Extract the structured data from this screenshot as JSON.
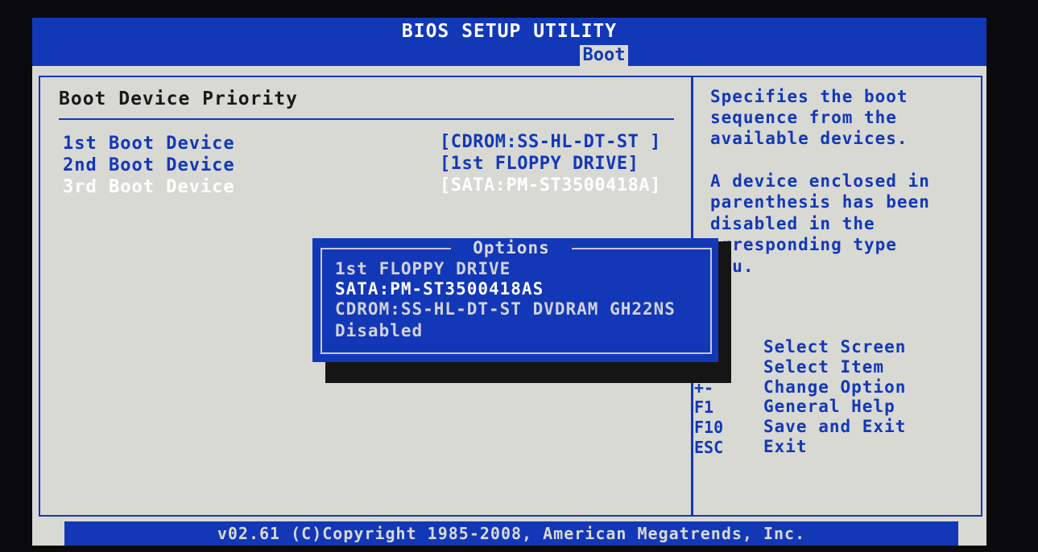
{
  "header": {
    "title": "BIOS SETUP UTILITY",
    "active_tab": "Boot"
  },
  "main": {
    "section_title": "Boot Device Priority",
    "rows": [
      {
        "label": "1st Boot Device",
        "value": "[CDROM:SS-HL-DT-ST ]"
      },
      {
        "label": "2nd Boot Device",
        "value": "[1st FLOPPY DRIVE]"
      },
      {
        "label": "3rd Boot Device",
        "value": "[SATA:PM-ST3500418A]"
      }
    ]
  },
  "popup": {
    "title": "Options",
    "options": [
      "1st FLOPPY DRIVE",
      "SATA:PM-ST3500418AS",
      "CDROM:SS-HL-DT-ST DVDRAM GH22NS",
      "Disabled"
    ],
    "selected_index": 1
  },
  "help": {
    "lines": [
      "Specifies the boot",
      "sequence from the",
      "available devices.",
      "",
      "A device enclosed in",
      "parenthesis has been",
      "disabled in the",
      "orresponding type",
      "enu."
    ],
    "keys": [
      {
        "key": "",
        "desc": "Select Screen"
      },
      {
        "key": "↑↓",
        "desc": "Select Item"
      },
      {
        "key": "+-",
        "desc": "Change Option"
      },
      {
        "key": "F1",
        "desc": "General Help"
      },
      {
        "key": "F10",
        "desc": "Save and Exit"
      },
      {
        "key": "ESC",
        "desc": "Exit"
      }
    ]
  },
  "footer": {
    "text": "v02.61 (C)Copyright 1985-2008, American Megatrends, Inc."
  },
  "colors": {
    "bios_blue": "#1238b8",
    "bios_gray": "#d9d9d4",
    "highlight": "#ffffff"
  }
}
